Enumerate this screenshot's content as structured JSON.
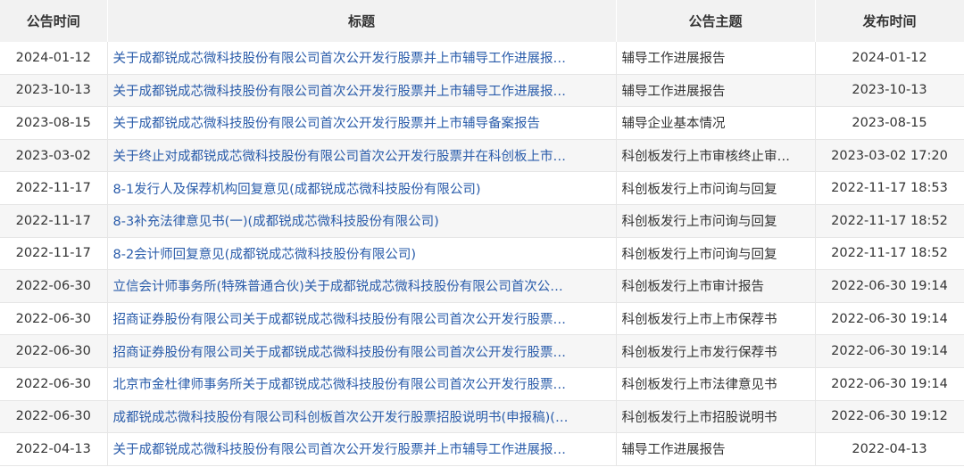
{
  "table": {
    "headers": [
      "公告时间",
      "标题",
      "公告主题",
      "发布时间"
    ],
    "rows": [
      {
        "date": "2024-01-12",
        "title": "关于成都锐成芯微科技股份有限公司首次公开发行股票并上市辅导工作进展报…",
        "topic": "辅导工作进展报告",
        "published": "2024-01-12"
      },
      {
        "date": "2023-10-13",
        "title": "关于成都锐成芯微科技股份有限公司首次公开发行股票并上市辅导工作进展报…",
        "topic": "辅导工作进展报告",
        "published": "2023-10-13"
      },
      {
        "date": "2023-08-15",
        "title": "关于成都锐成芯微科技股份有限公司首次公开发行股票并上市辅导备案报告",
        "topic": "辅导企业基本情况",
        "published": "2023-08-15"
      },
      {
        "date": "2023-03-02",
        "title": "关于终止对成都锐成芯微科技股份有限公司首次公开发行股票并在科创板上市…",
        "topic": "科创板发行上市审核终止审…",
        "published": "2023-03-02 17:20"
      },
      {
        "date": "2022-11-17",
        "title": "8-1发行人及保荐机构回复意见(成都锐成芯微科技股份有限公司)",
        "topic": "科创板发行上市问询与回复",
        "published": "2022-11-17 18:53"
      },
      {
        "date": "2022-11-17",
        "title": "8-3补充法律意见书(一)(成都锐成芯微科技股份有限公司)",
        "topic": "科创板发行上市问询与回复",
        "published": "2022-11-17 18:52"
      },
      {
        "date": "2022-11-17",
        "title": "8-2会计师回复意见(成都锐成芯微科技股份有限公司)",
        "topic": "科创板发行上市问询与回复",
        "published": "2022-11-17 18:52"
      },
      {
        "date": "2022-06-30",
        "title": "立信会计师事务所(特殊普通合伙)关于成都锐成芯微科技股份有限公司首次公…",
        "topic": "科创板发行上市审计报告",
        "published": "2022-06-30 19:14"
      },
      {
        "date": "2022-06-30",
        "title": "招商证券股份有限公司关于成都锐成芯微科技股份有限公司首次公开发行股票…",
        "topic": "科创板发行上市上市保荐书",
        "published": "2022-06-30 19:14"
      },
      {
        "date": "2022-06-30",
        "title": "招商证券股份有限公司关于成都锐成芯微科技股份有限公司首次公开发行股票…",
        "topic": "科创板发行上市发行保荐书",
        "published": "2022-06-30 19:14"
      },
      {
        "date": "2022-06-30",
        "title": "北京市金杜律师事务所关于成都锐成芯微科技股份有限公司首次公开发行股票…",
        "topic": "科创板发行上市法律意见书",
        "published": "2022-06-30 19:14"
      },
      {
        "date": "2022-06-30",
        "title": "成都锐成芯微科技股份有限公司科创板首次公开发行股票招股说明书(申报稿)(…",
        "topic": "科创板发行上市招股说明书",
        "published": "2022-06-30 19:12"
      },
      {
        "date": "2022-04-13",
        "title": "关于成都锐成芯微科技股份有限公司首次公开发行股票并上市辅导工作进展报…",
        "topic": "辅导工作进展报告",
        "published": "2022-04-13"
      }
    ]
  }
}
